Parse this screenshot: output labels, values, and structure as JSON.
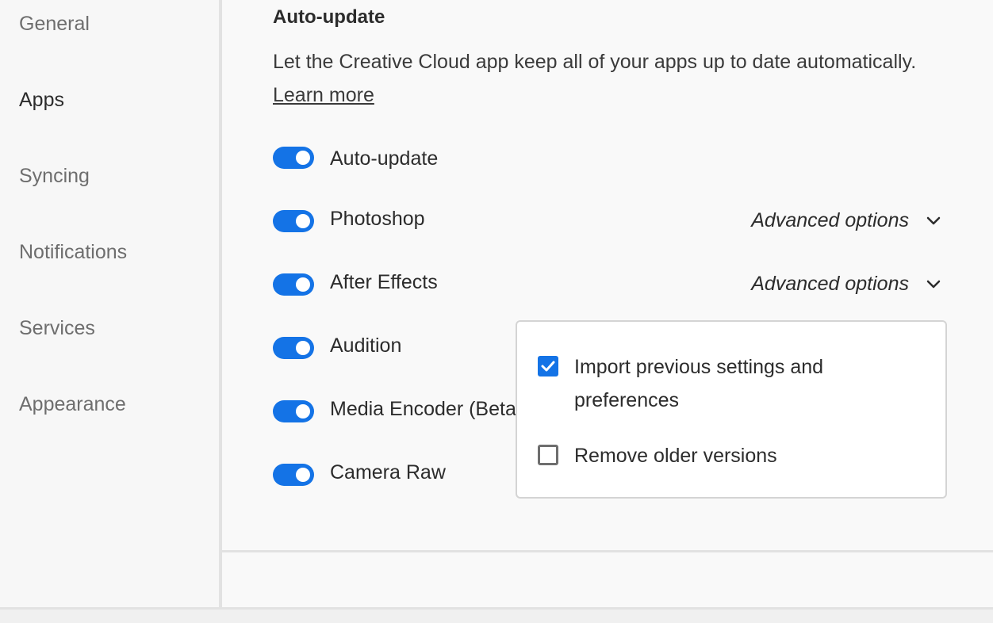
{
  "sidebar": {
    "items": [
      {
        "label": "General"
      },
      {
        "label": "Apps"
      },
      {
        "label": "Syncing"
      },
      {
        "label": "Notifications"
      },
      {
        "label": "Services"
      },
      {
        "label": "Appearance"
      }
    ],
    "active": "Apps"
  },
  "main": {
    "section_title": "Auto-update",
    "description": "Let the Creative Cloud app keep all of your apps up to date automatically.",
    "learn_more": "Learn more",
    "toggles": [
      {
        "label": "Auto-update",
        "on": true
      },
      {
        "label": "Photoshop",
        "on": true,
        "advanced": "Advanced options"
      },
      {
        "label": "After Effects",
        "on": true,
        "advanced": "Advanced options"
      },
      {
        "label": "Audition",
        "on": true
      },
      {
        "label": "Media Encoder (Beta",
        "on": true
      },
      {
        "label": "Camera Raw",
        "on": true
      }
    ]
  },
  "popover": {
    "options": [
      {
        "label": "Import previous settings and preferences",
        "checked": true
      },
      {
        "label": "Remove older versions",
        "checked": false
      }
    ]
  },
  "colors": {
    "accent": "#1473e6"
  }
}
